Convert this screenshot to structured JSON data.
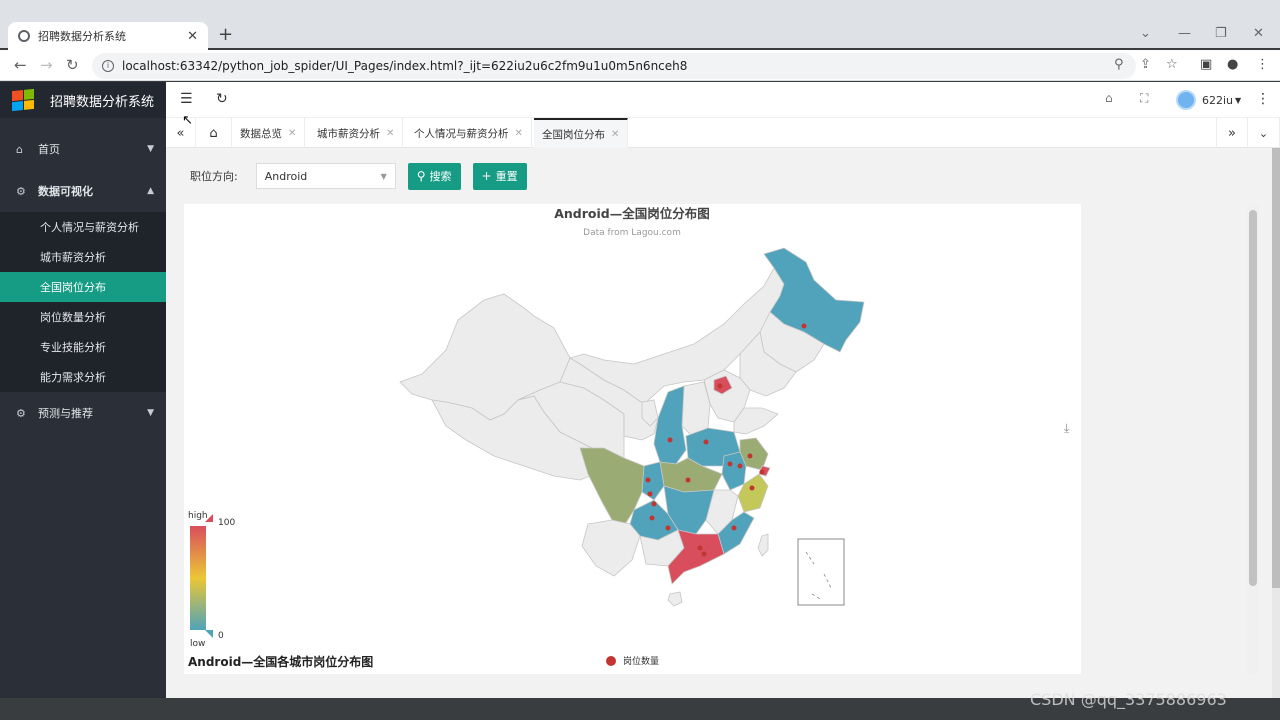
{
  "browser": {
    "tab_title": "招聘数据分析系统",
    "url": "localhost:63342/python_job_spider/UI_Pages/index.html?_ijt=622iu2u6c2fm9u1u0m5n6nceh8"
  },
  "app": {
    "title": "招聘数据分析系统",
    "user": "622iu"
  },
  "sidebar": {
    "items": [
      {
        "label": "首页",
        "icon": "home-icon"
      },
      {
        "label": "数据可视化",
        "icon": "gear-icon"
      },
      {
        "label": "预测与推荐",
        "icon": "gear-icon"
      }
    ],
    "sub_items": [
      {
        "label": "个人情况与薪资分析"
      },
      {
        "label": "城市薪资分析"
      },
      {
        "label": "全国岗位分布"
      },
      {
        "label": "岗位数量分析"
      },
      {
        "label": "专业技能分析"
      },
      {
        "label": "能力需求分析"
      }
    ]
  },
  "page_tabs": [
    {
      "label": "数据总览"
    },
    {
      "label": "城市薪资分析"
    },
    {
      "label": "个人情况与薪资分析"
    },
    {
      "label": "全国岗位分布"
    }
  ],
  "filter": {
    "label": "职位方向:",
    "selected": "Android",
    "search_label": "搜索",
    "reset_label": "重置"
  },
  "chart": {
    "title": "Android—全国岗位分布图",
    "subtitle": "Data from Lagou.com",
    "bottom_title": "Android—全国各城市岗位分布图",
    "legend_label": "岗位数量",
    "visualmap": {
      "high": "high",
      "low": "low",
      "max": "100",
      "min": "0"
    }
  },
  "chart_data": {
    "type": "map",
    "title": "Android—全国岗位分布图",
    "subtitle": "Data from Lagou.com",
    "visualmap_range": [
      0,
      100
    ],
    "colors": {
      "high": "#d94e5d",
      "mid_high": "#eac736",
      "mid": "#9aac74",
      "low": "#50a3ba",
      "none": "#ececec"
    }
  },
  "watermark": "CSDN @qq_3375886963"
}
